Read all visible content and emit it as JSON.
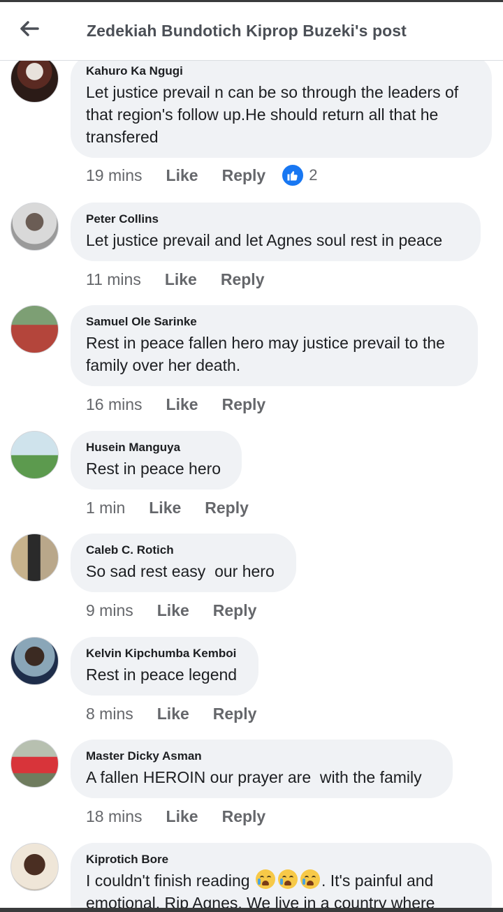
{
  "header": {
    "title": "Zedekiah Bundotich Kiprop Buzeki's post",
    "back_icon": "arrow-left-icon"
  },
  "actions": {
    "like_label": "Like",
    "reply_label": "Reply"
  },
  "colors": {
    "like_blue": "#1877f2",
    "bubble": "#f0f2f5",
    "meta_gray": "#65676b"
  },
  "comments": [
    {
      "author": "Kahuro Ka Ngugi",
      "text": "Let justice prevail n can be so through the leaders of that region's follow up.He should return all that he transfered",
      "time": "19 mins",
      "reaction_count": "2"
    },
    {
      "author": "Peter Collins",
      "text": "Let justice prevail and let Agnes soul rest in peace",
      "time": "11 mins"
    },
    {
      "author": "Samuel Ole Sarinke",
      "text": "Rest in peace fallen hero may justice prevail to the family over her death.",
      "time": "16 mins"
    },
    {
      "author": "Husein Manguya",
      "text": "Rest in peace hero",
      "time": "1 min"
    },
    {
      "author": "Caleb C. Rotich",
      "text": "So sad rest easy  our hero",
      "time": "9 mins"
    },
    {
      "author": "Kelvin Kipchumba Kemboi",
      "text": "Rest in peace legend",
      "time": "8 mins"
    },
    {
      "author": "Master Dicky Asman",
      "text": "A fallen HEROIN our prayer are  with the family",
      "time": "18 mins"
    },
    {
      "author": "Kiprotich Bore",
      "text_before": "I couldn't finish reading ",
      "text_after": ". It's painful and emotional. Rip Agnes. We live in a country where",
      "emoji": "loudly-crying-face"
    }
  ]
}
